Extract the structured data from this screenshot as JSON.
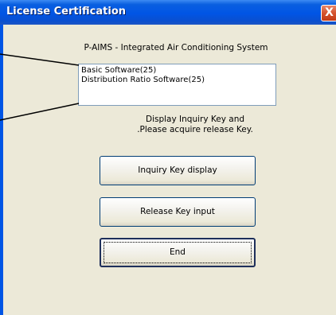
{
  "window": {
    "title": "License Certification",
    "close_label": "X"
  },
  "dialog": {
    "app_title": "P-AIMS - Integrated Air Conditioning System",
    "licenses": [
      "Basic Software(25)",
      "Distribution Ratio Software(25)"
    ],
    "info_line1": "Display Inquiry Key and",
    "info_line2": ".Please acquire release Key.",
    "buttons": {
      "inquiry": "Inquiry Key display",
      "release": "Release Key input",
      "end": "End"
    }
  },
  "colors": {
    "titlebar": "#0055e5",
    "client_bg": "#ece9d8",
    "close_button": "#d4532f",
    "button_border": "#003c74"
  }
}
